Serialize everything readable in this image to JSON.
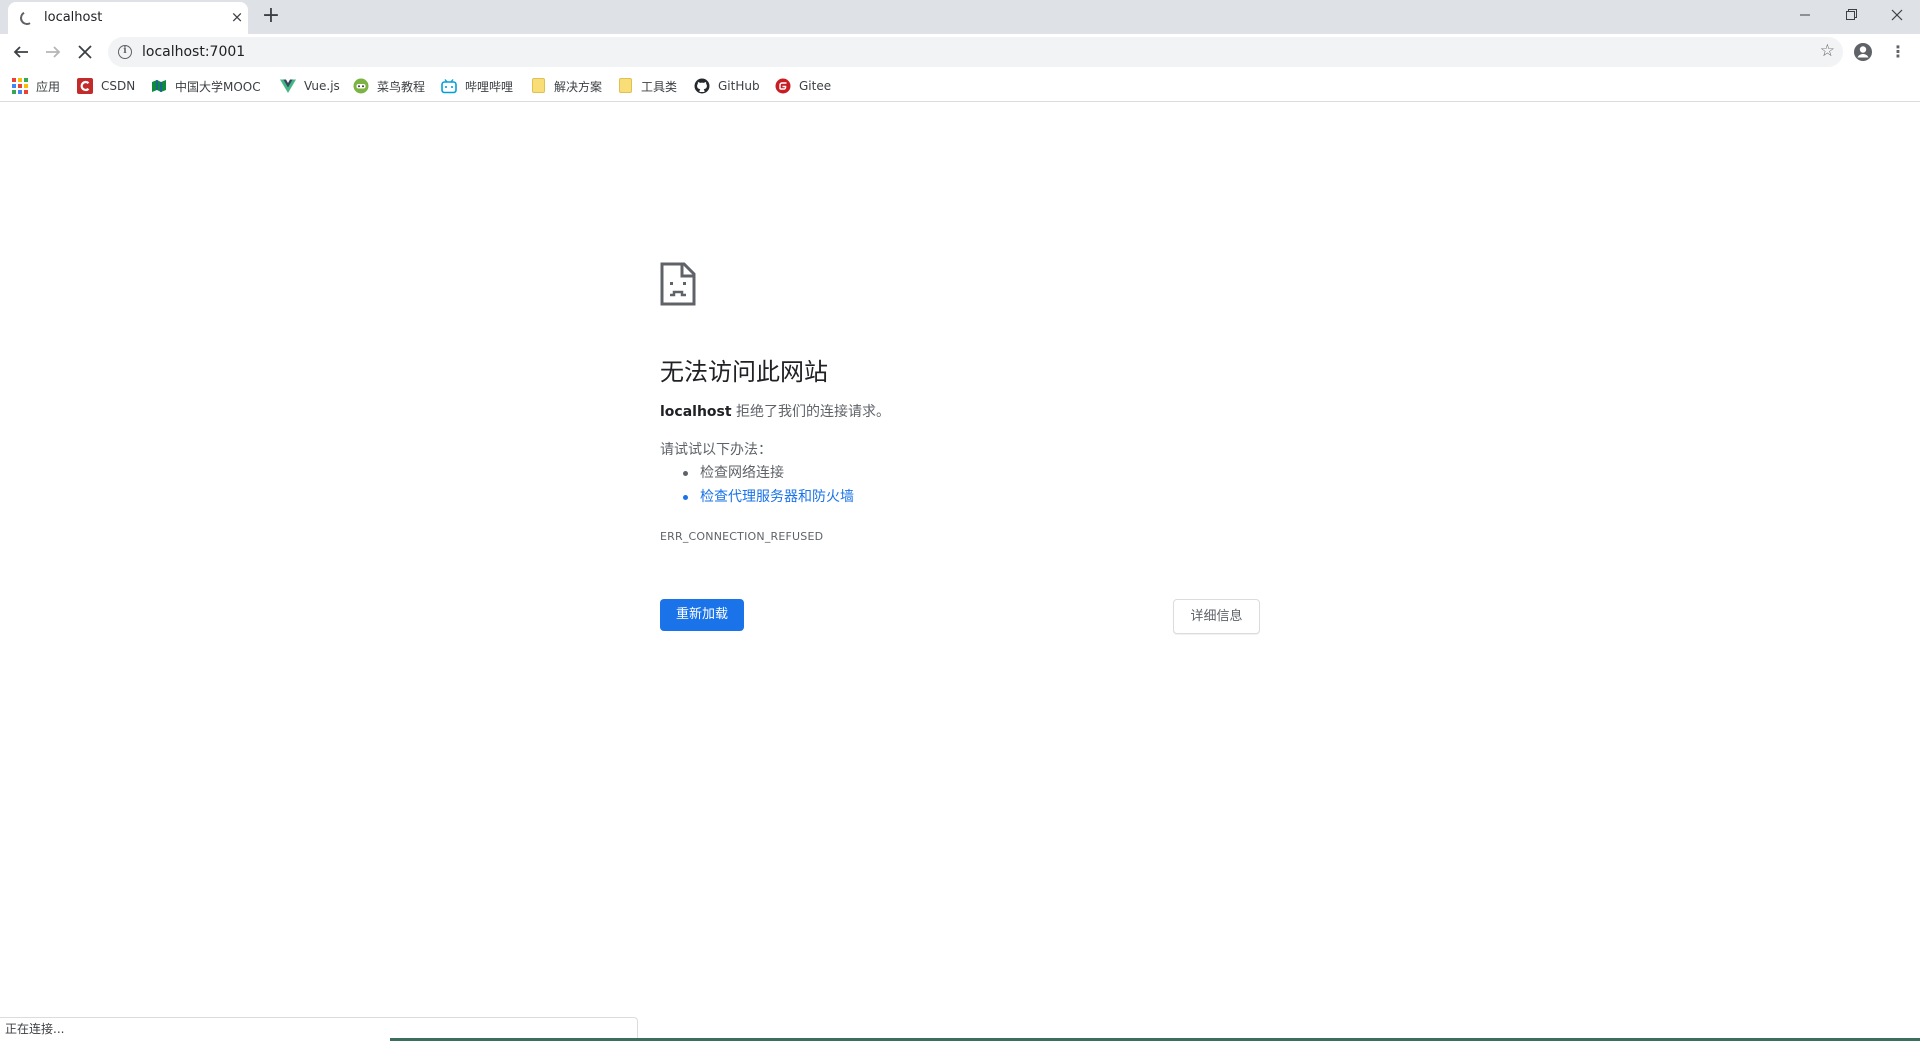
{
  "tab": {
    "title": "localhost",
    "close_icon": "×",
    "new_tab_icon": "+"
  },
  "toolbar": {
    "url": "localhost:7001",
    "info_icon": "i",
    "star_icon": "☆",
    "menu_icon": "⋮"
  },
  "bookmarks": [
    {
      "label": "应用",
      "icon": "apps-grid-icon"
    },
    {
      "label": "CSDN",
      "icon": "csdn-icon",
      "color": "#c32a2a"
    },
    {
      "label": "中国大学MOOC",
      "icon": "mooc-icon",
      "color": "#0d8a3c"
    },
    {
      "label": "Vue.js",
      "icon": "vue-icon",
      "color": "#41b883"
    },
    {
      "label": "菜鸟教程",
      "icon": "runoob-icon",
      "color": "#7cb342"
    },
    {
      "label": "哔哩哔哩",
      "icon": "bilibili-icon",
      "color": "#00a1d6"
    },
    {
      "label": "解决方案",
      "icon": "folder-icon",
      "color": "#f9dd77"
    },
    {
      "label": "工具类",
      "icon": "folder-icon",
      "color": "#f9dd77"
    },
    {
      "label": "GitHub",
      "icon": "github-icon",
      "color": "#24292e"
    },
    {
      "label": "Gitee",
      "icon": "gitee-icon",
      "color": "#c71d23"
    }
  ],
  "error": {
    "title": "无法访问此网站",
    "host": "localhost",
    "message": " 拒绝了我们的连接请求。",
    "try_label": "请试试以下办法：",
    "suggestions": [
      "检查网络连接",
      "检查代理服务器和防火墙"
    ],
    "code": "ERR_CONNECTION_REFUSED",
    "reload_label": "重新加载",
    "details_label": "详细信息"
  },
  "status": {
    "text": "正在连接..."
  },
  "colors": {
    "accent": "#1a73e8",
    "tabstrip": "#dee1e6"
  }
}
